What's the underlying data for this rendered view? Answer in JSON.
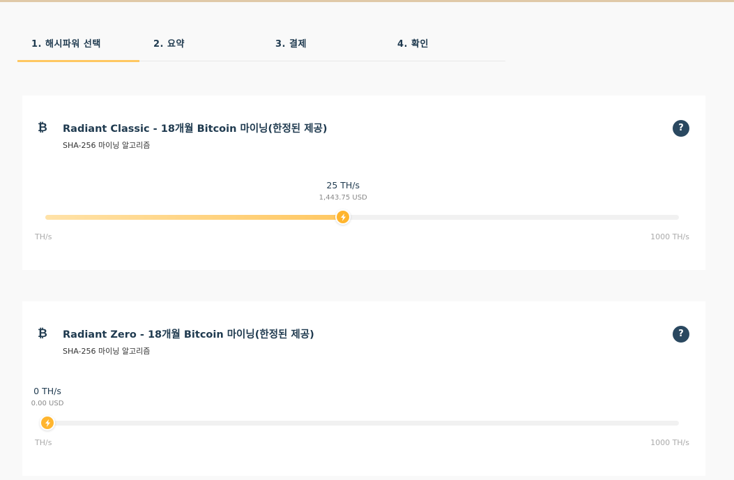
{
  "steps": [
    {
      "label": "1. 해시파워 선택"
    },
    {
      "label": "2. 요약"
    },
    {
      "label": "3. 결제"
    },
    {
      "label": "4. 확인"
    }
  ],
  "products": [
    {
      "coin_symbol": "₿",
      "title": "Radiant Classic - 18개월 Bitcoin 마이닝(한정된 제공)",
      "subtitle": "SHA-256 마이닝 알고리즘",
      "help": "?",
      "hashrate_label": "25 TH/s",
      "price_label": "1,443.75 USD",
      "slider_percent": 47,
      "min_label": "TH/s",
      "max_label": "1000 TH/s"
    },
    {
      "coin_symbol": "₿",
      "title": "Radiant Zero - 18개월 Bitcoin 마이닝(한정된 제공)",
      "subtitle": "SHA-256 마이닝 알고리즘",
      "help": "?",
      "hashrate_label": "0 TH/s",
      "price_label": "0.00 USD",
      "slider_percent": 0,
      "min_label": "TH/s",
      "max_label": "1000 TH/s"
    }
  ],
  "colors": {
    "accent": "#ffc862",
    "handle": "#ffb52e",
    "navy": "#1f3a4f"
  }
}
